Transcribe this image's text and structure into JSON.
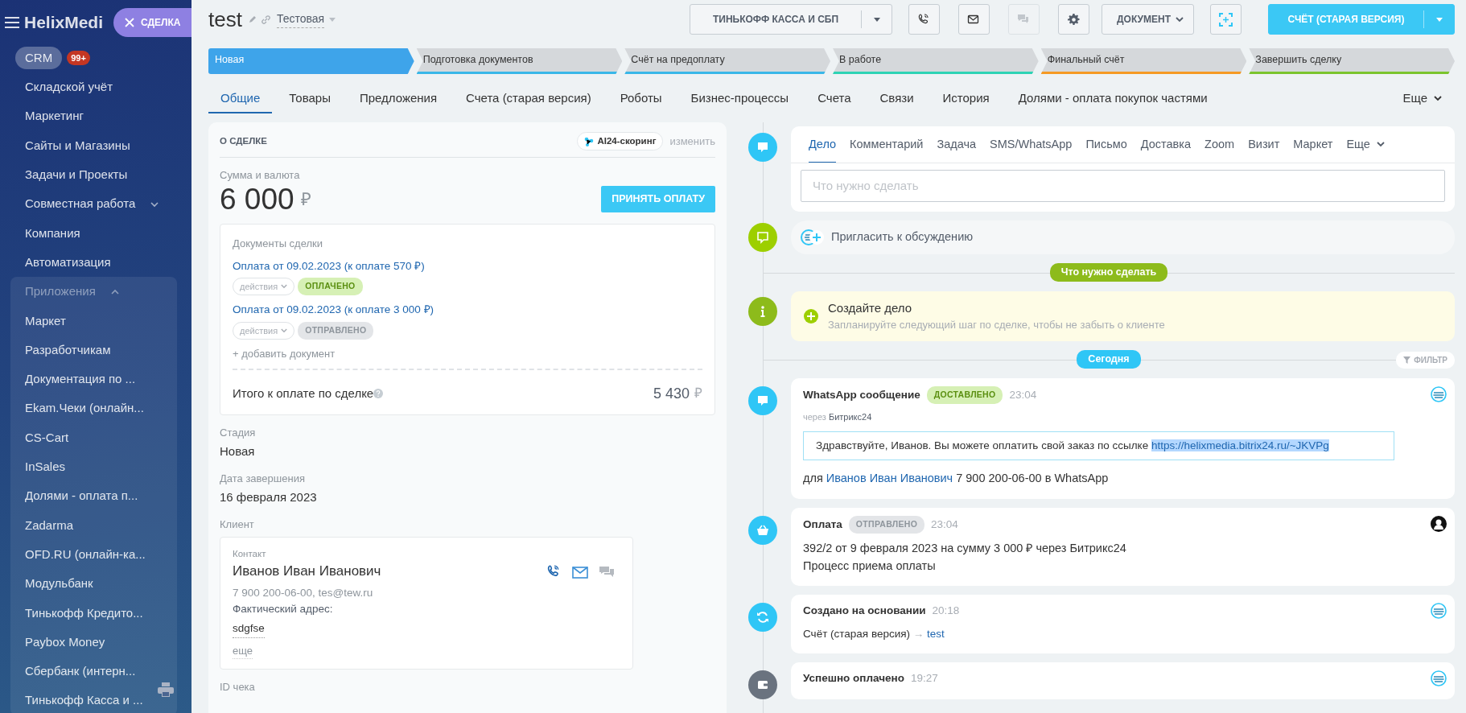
{
  "sidebar": {
    "logo": "HelixMedi",
    "entity_pill": {
      "label": "СДЕЛКА"
    },
    "items": [
      {
        "label": "CRM",
        "badge": "99+",
        "selected": true
      },
      {
        "label": "Складской учёт",
        "selected": false
      },
      {
        "label": "Маркетинг",
        "selected": false
      },
      {
        "label": "Сайты и Магазины",
        "selected": false
      },
      {
        "label": "Задачи и Проекты",
        "selected": false
      },
      {
        "label": "Совместная работа",
        "selected": false,
        "expanded": false
      },
      {
        "label": "Компания",
        "selected": false
      },
      {
        "label": "Автоматизация",
        "selected": false
      },
      {
        "label": "Приложения",
        "selected": false,
        "expanded": true,
        "children": [
          {
            "label": "Маркет",
            "selected": false
          },
          {
            "label": "Разработчикам",
            "selected": false
          },
          {
            "label": "Документация по ...",
            "selected": false
          },
          {
            "label": "Ekam.Чеки (онлайн...",
            "selected": false
          },
          {
            "label": "CS-Cart",
            "selected": false
          },
          {
            "label": "InSales",
            "selected": false
          },
          {
            "label": "Долями - оплата п...",
            "selected": false
          },
          {
            "label": "Zadarma",
            "selected": false
          },
          {
            "label": "OFD.RU (онлайн-ка...",
            "selected": false
          },
          {
            "label": "Модульбанк",
            "selected": false
          },
          {
            "label": "Тинькофф Кредито...",
            "selected": false
          },
          {
            "label": "Paybox Money",
            "selected": false
          },
          {
            "label": "Сбербанк (интерн...",
            "selected": false
          },
          {
            "label": "Тинькофф Касса и ...",
            "selected": false
          }
        ]
      }
    ]
  },
  "header": {
    "title": "test",
    "category": "Тестовая",
    "actions": [
      {
        "kind": "split",
        "label": "ТИНЬКОФФ КАССА И СБП"
      },
      {
        "kind": "icon",
        "disabled": false
      },
      {
        "kind": "icon",
        "disabled": false
      },
      {
        "kind": "icon",
        "disabled": true
      },
      {
        "kind": "icon",
        "disabled": false
      },
      {
        "kind": "dropdown",
        "label": "ДОКУМЕНТ"
      },
      {
        "kind": "icon",
        "disabled": false
      },
      {
        "kind": "primary-split",
        "label": "СЧЁТ (СТАРАЯ ВЕРСИЯ)"
      }
    ]
  },
  "stages": [
    {
      "label": "Новая",
      "selected": true,
      "color": "#3ea4ea"
    },
    {
      "label": "Подготовка документов",
      "selected": false,
      "color": "#39b7e8"
    },
    {
      "label": "Счёт на предоплату",
      "selected": false,
      "color": "#39b7e8"
    },
    {
      "label": "В работе",
      "selected": false,
      "color": "#2ed3b4"
    },
    {
      "label": "Финальный счёт",
      "selected": false,
      "color": "#f59a24"
    },
    {
      "label": "Завершить сделку",
      "selected": false,
      "color": "#7bc42d"
    }
  ],
  "tabs": [
    {
      "label": "Общие",
      "selected": true
    },
    {
      "label": "Товары",
      "selected": false
    },
    {
      "label": "Предложения",
      "selected": false
    },
    {
      "label": "Счета (старая версия)",
      "selected": false
    },
    {
      "label": "Роботы",
      "selected": false
    },
    {
      "label": "Бизнес-процессы",
      "selected": false
    },
    {
      "label": "Счета",
      "selected": false
    },
    {
      "label": "Связи",
      "selected": false
    },
    {
      "label": "История",
      "selected": false
    },
    {
      "label": "Долями - оплата покупок частями",
      "selected": false
    }
  ],
  "tabs_more": "Еще",
  "deal": {
    "title": "О СДЕЛКЕ",
    "scoring": "AI24-скоринг",
    "edit": "изменить",
    "amount_label": "Сумма и валюта",
    "amount": "6 000",
    "currency": "₽",
    "accept_button": "ПРИНЯТЬ ОПЛАТУ",
    "documents": {
      "title": "Документы сделки",
      "items": [
        {
          "link": "Оплата от 09.02.2023 (к оплате 570 ₽)",
          "actions": "действия",
          "status": "ОПЛАЧЕНО",
          "kind": "paid"
        },
        {
          "link": "Оплата от 09.02.2023 (к оплате 3 000 ₽)",
          "actions": "действия",
          "status": "ОТПРАВЛЕНО",
          "kind": "sent"
        }
      ],
      "add": "+ добавить документ",
      "total_label": "Итого к оплате по сделке",
      "total": "5 430",
      "currency": "₽"
    },
    "fields": [
      {
        "label": "Стадия",
        "value": "Новая"
      },
      {
        "label": "Дата завершения",
        "value": "16 февраля 2023"
      }
    ],
    "client_label": "Клиент",
    "contact": {
      "type": "Контакт",
      "name": "Иванов Иван Иванович",
      "details": "7 900 200-06-00, tes@tew.ru",
      "address_label": "Фактический адрес:",
      "address": "sdgfse",
      "more": "еще"
    },
    "receipt_label": "ID чека"
  },
  "timeline": {
    "composer": {
      "tabs": [
        {
          "label": "Дело",
          "selected": true
        },
        {
          "label": "Комментарий",
          "selected": false
        },
        {
          "label": "Задача",
          "selected": false
        },
        {
          "label": "SMS/WhatsApp",
          "selected": false
        },
        {
          "label": "Письмо",
          "selected": false
        },
        {
          "label": "Доставка",
          "selected": false
        },
        {
          "label": "Zoom",
          "selected": false
        },
        {
          "label": "Визит",
          "selected": false
        },
        {
          "label": "Маркет",
          "selected": false
        }
      ],
      "more": "Еще",
      "placeholder": "Что нужно сделать"
    },
    "invite": "Пригласить к обсуждению",
    "todo_divider": "Что нужно сделать",
    "create": {
      "title": "Создайте дело",
      "subtitle": "Запланируйте следующий шаг по сделке, чтобы не забыть о клиенте"
    },
    "today_divider": "Сегодня",
    "filter": "ФИЛЬТР",
    "events": [
      {
        "kind": "whatsapp",
        "color": "#2fc6f6",
        "title": "WhatsApp сообщение",
        "status": "ДОСТАВЛЕНО",
        "success": true,
        "time": "23:04",
        "via": "через",
        "via_name": "Битрикс24",
        "message": "Здравствуйте, Иванов. Вы можете оплатить свой заказ по ссылке",
        "message_link": "https://helixmedia.bitrix24.ru/~JKVPg",
        "to": "для",
        "to_link": "Иванов Иван Иванович",
        "to_rest": "7 900 200-06-00 в WhatsApp"
      },
      {
        "kind": "payment",
        "color": "#2fc6f6",
        "title": "Оплата",
        "status": "ОТПРАВЛЕНО",
        "success": false,
        "time": "23:04",
        "body": "392/2 от 9 февраля 2023 на сумму 3 000 ₽ через Битрикс24",
        "link": "Процесс приема оплаты"
      },
      {
        "kind": "created",
        "color": "#2fc6f6",
        "title": "Создано на основании",
        "time": "20:18",
        "from": "Счёт (старая версия)",
        "arrow": "→",
        "link": "test"
      },
      {
        "kind": "paid",
        "color": "#6a737f",
        "title": "Успешно оплачено",
        "time": "19:27"
      }
    ]
  }
}
